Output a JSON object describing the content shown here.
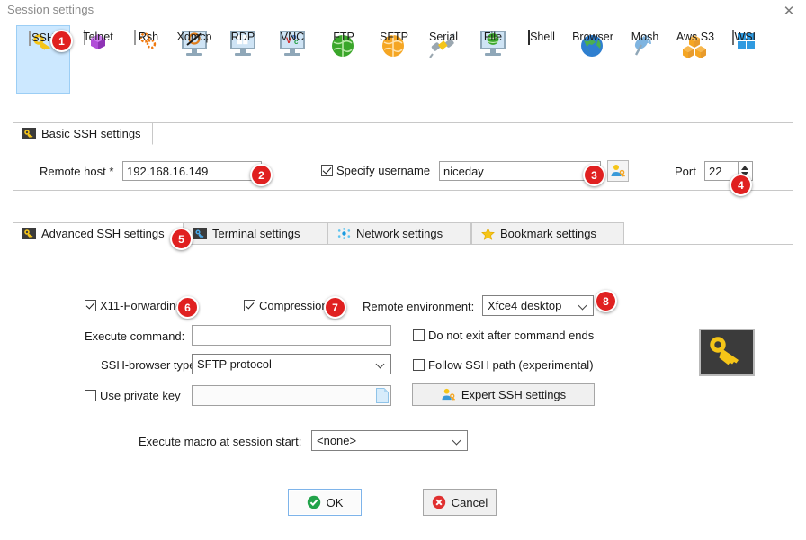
{
  "window": {
    "title": "Session settings",
    "close_label": "✕"
  },
  "session_types": [
    {
      "label": "SSH",
      "icon": "ssh-key-icon",
      "selected": true
    },
    {
      "label": "Telnet",
      "icon": "telnet-cube-icon",
      "selected": false
    },
    {
      "label": "Rsh",
      "icon": "rsh-gears-icon",
      "selected": false
    },
    {
      "label": "Xdmcp",
      "icon": "xdmcp-monitor-icon",
      "selected": false
    },
    {
      "label": "RDP",
      "icon": "rdp-monitor-icon",
      "selected": false
    },
    {
      "label": "VNC",
      "icon": "vnc-monitor-icon",
      "selected": false
    },
    {
      "label": "FTP",
      "icon": "ftp-globe-icon",
      "selected": false
    },
    {
      "label": "SFTP",
      "icon": "sftp-globe-icon",
      "selected": false
    },
    {
      "label": "Serial",
      "icon": "serial-plug-icon",
      "selected": false
    },
    {
      "label": "File",
      "icon": "file-monitor-icon",
      "selected": false
    },
    {
      "label": "Shell",
      "icon": "shell-prompt-icon",
      "selected": false
    },
    {
      "label": "Browser",
      "icon": "browser-globe-icon",
      "selected": false
    },
    {
      "label": "Mosh",
      "icon": "mosh-dish-icon",
      "selected": false
    },
    {
      "label": "Aws S3",
      "icon": "aws-s3-cubes-icon",
      "selected": false
    },
    {
      "label": "WSL",
      "icon": "wsl-windows-icon",
      "selected": false
    }
  ],
  "basic": {
    "tab_label": "Basic SSH settings",
    "remote_host_label": "Remote host *",
    "remote_host_value": "192.168.16.149",
    "specify_username_label": "Specify username",
    "specify_username_checked": true,
    "username_value": "niceday",
    "port_label": "Port",
    "port_value": "22"
  },
  "advanced_tabs": [
    {
      "label": "Advanced SSH settings",
      "icon": "key-icon",
      "active": true
    },
    {
      "label": "Terminal settings",
      "icon": "terminal-icon",
      "active": false
    },
    {
      "label": "Network settings",
      "icon": "network-icon",
      "active": false
    },
    {
      "label": "Bookmark settings",
      "icon": "star-icon",
      "active": false
    }
  ],
  "advanced": {
    "x11_label": "X11-Forwarding",
    "x11_checked": true,
    "compression_label": "Compression",
    "compression_checked": true,
    "remote_env_label": "Remote environment:",
    "remote_env_value": "Xfce4 desktop",
    "execute_command_label": "Execute command:",
    "execute_command_value": "",
    "do_not_exit_label": "Do not exit after command ends",
    "do_not_exit_checked": false,
    "ssh_browser_label": "SSH-browser type:",
    "ssh_browser_value": "SFTP protocol",
    "follow_ssh_label": "Follow SSH path (experimental)",
    "follow_ssh_checked": false,
    "use_private_key_label": "Use private key",
    "use_private_key_checked": false,
    "private_key_value": "",
    "expert_button_label": "Expert SSH settings",
    "macro_label": "Execute macro at session start:",
    "macro_value": "<none>"
  },
  "footer": {
    "ok_label": "OK",
    "cancel_label": "Cancel"
  },
  "badges": [
    {
      "n": "1"
    },
    {
      "n": "2"
    },
    {
      "n": "3"
    },
    {
      "n": "4"
    },
    {
      "n": "5"
    },
    {
      "n": "6"
    },
    {
      "n": "7"
    },
    {
      "n": "8"
    }
  ],
  "colors": {
    "badge_red": "#e02020",
    "selection_blue": "#cce8ff",
    "ok_green": "#22a34a",
    "cancel_red": "#e03030",
    "key_yellow": "#f5c518"
  }
}
